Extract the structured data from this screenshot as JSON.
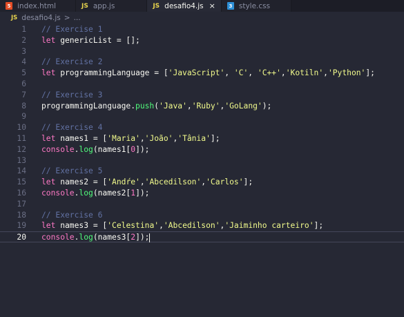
{
  "tabs": [
    {
      "label": "index.html",
      "icon": "html-file-icon",
      "active": false
    },
    {
      "label": "app.js",
      "icon": "js-file-icon",
      "active": false
    },
    {
      "label": "desafio4.js",
      "icon": "js-file-icon",
      "active": true
    },
    {
      "label": "style.css",
      "icon": "css-file-icon",
      "active": false
    }
  ],
  "icon_text": {
    "html": "5",
    "js": "JS",
    "css": "3"
  },
  "close_glyph": "×",
  "breadcrumb": {
    "file": "desafio4.js",
    "separator": ">",
    "rest": "..."
  },
  "current_line": 20,
  "lines": [
    {
      "n": "1",
      "tokens": [
        [
          "comment",
          "// Exercise 1"
        ]
      ]
    },
    {
      "n": "2",
      "tokens": [
        [
          "kw",
          "let"
        ],
        [
          "var",
          " genericList = [];"
        ]
      ]
    },
    {
      "n": "3",
      "tokens": []
    },
    {
      "n": "4",
      "tokens": [
        [
          "comment",
          "// Exercise 2"
        ]
      ]
    },
    {
      "n": "5",
      "tokens": [
        [
          "kw",
          "let"
        ],
        [
          "var",
          " programmingLanguage = ["
        ],
        [
          "str",
          "'JavaScript'"
        ],
        [
          "var",
          ", "
        ],
        [
          "str",
          "'C'"
        ],
        [
          "var",
          ", "
        ],
        [
          "str",
          "'C++'"
        ],
        [
          "var",
          ","
        ],
        [
          "str",
          "'Kotiln'"
        ],
        [
          "var",
          ","
        ],
        [
          "str",
          "'Python'"
        ],
        [
          "var",
          "];"
        ]
      ]
    },
    {
      "n": "6",
      "tokens": []
    },
    {
      "n": "7",
      "tokens": [
        [
          "comment",
          "// Exercise 3"
        ]
      ]
    },
    {
      "n": "8",
      "tokens": [
        [
          "var",
          "programmingLanguage."
        ],
        [
          "fn",
          "push"
        ],
        [
          "var",
          "("
        ],
        [
          "str",
          "'Java'"
        ],
        [
          "var",
          ","
        ],
        [
          "str",
          "'Ruby'"
        ],
        [
          "var",
          ","
        ],
        [
          "str",
          "'GoLang'"
        ],
        [
          "var",
          ");"
        ]
      ]
    },
    {
      "n": "9",
      "tokens": []
    },
    {
      "n": "10",
      "tokens": [
        [
          "comment",
          "// Exercise 4"
        ]
      ]
    },
    {
      "n": "11",
      "tokens": [
        [
          "kw",
          "let"
        ],
        [
          "var",
          " names1 = ["
        ],
        [
          "str",
          "'Maria'"
        ],
        [
          "var",
          ","
        ],
        [
          "str",
          "'João'"
        ],
        [
          "var",
          ","
        ],
        [
          "str",
          "'Tânia'"
        ],
        [
          "var",
          "];"
        ]
      ]
    },
    {
      "n": "12",
      "tokens": [
        [
          "kw",
          "console"
        ],
        [
          "var",
          "."
        ],
        [
          "fn",
          "log"
        ],
        [
          "var",
          "(names1["
        ],
        [
          "kw",
          "0"
        ],
        [
          "var",
          "]);"
        ]
      ]
    },
    {
      "n": "13",
      "tokens": []
    },
    {
      "n": "14",
      "tokens": [
        [
          "comment",
          "// Exercise 5"
        ]
      ]
    },
    {
      "n": "15",
      "tokens": [
        [
          "kw",
          "let"
        ],
        [
          "var",
          " names2 = ["
        ],
        [
          "str",
          "'Andŕe'"
        ],
        [
          "var",
          ","
        ],
        [
          "str",
          "'Abcedilson'"
        ],
        [
          "var",
          ","
        ],
        [
          "str",
          "'Carlos'"
        ],
        [
          "var",
          "];"
        ]
      ]
    },
    {
      "n": "16",
      "tokens": [
        [
          "kw",
          "console"
        ],
        [
          "var",
          "."
        ],
        [
          "fn",
          "log"
        ],
        [
          "var",
          "(names2["
        ],
        [
          "kw",
          "1"
        ],
        [
          "var",
          "]);"
        ]
      ]
    },
    {
      "n": "17",
      "tokens": []
    },
    {
      "n": "18",
      "tokens": [
        [
          "comment",
          "// Exercise 6"
        ]
      ]
    },
    {
      "n": "19",
      "tokens": [
        [
          "kw",
          "let"
        ],
        [
          "var",
          " names3 = ["
        ],
        [
          "str",
          "'Celestina'"
        ],
        [
          "var",
          ","
        ],
        [
          "str",
          "'Abcedilson'"
        ],
        [
          "var",
          ","
        ],
        [
          "str",
          "'Jaiminho carteiro'"
        ],
        [
          "var",
          "];"
        ]
      ]
    },
    {
      "n": "20",
      "tokens": [
        [
          "kw",
          "console"
        ],
        [
          "var",
          "."
        ],
        [
          "fn",
          "log"
        ],
        [
          "var",
          "(names3["
        ],
        [
          "kw",
          "2"
        ],
        [
          "var",
          "]);"
        ]
      ]
    }
  ],
  "colors": {
    "background": "#262834",
    "comment": "#6272a4",
    "keyword": "#ff79c6",
    "string": "#f1fa8c",
    "function": "#50fa7b",
    "text": "#f8f8f2"
  }
}
